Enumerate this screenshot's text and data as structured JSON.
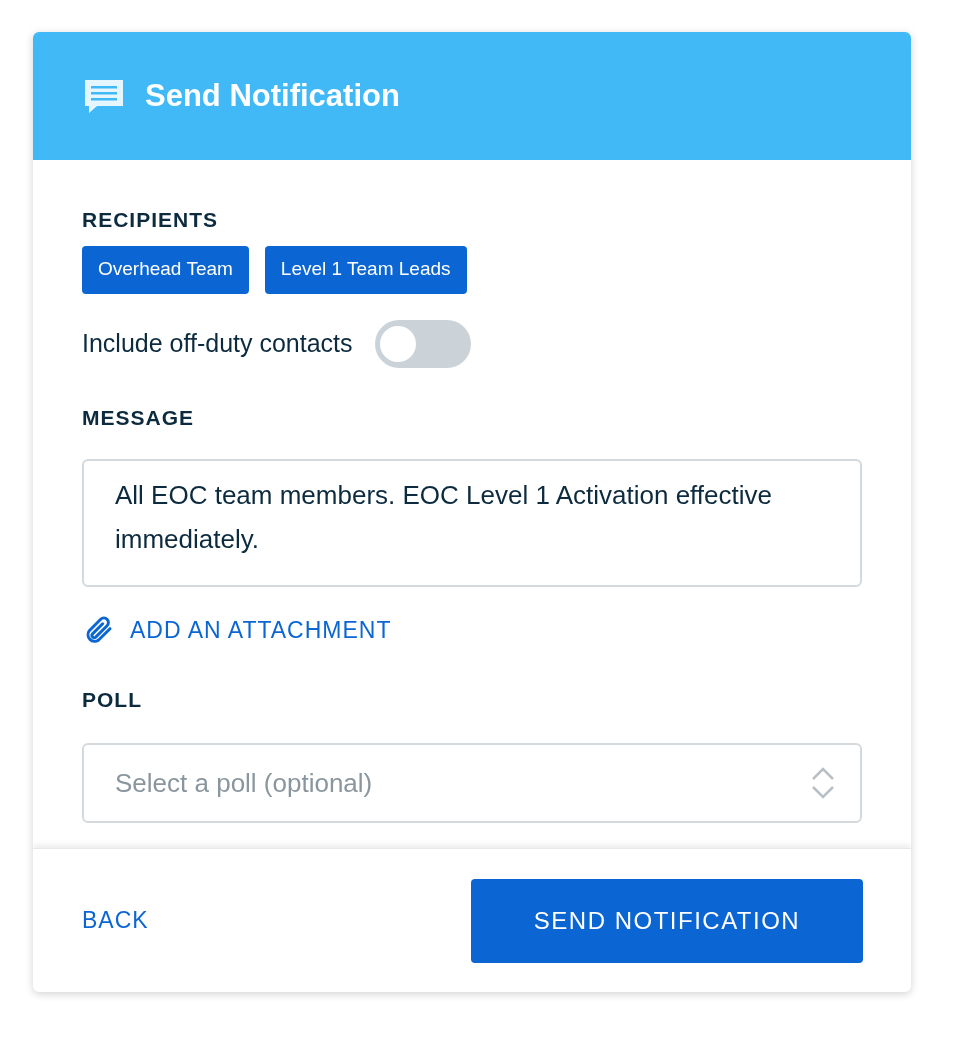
{
  "header": {
    "title": "Send Notification"
  },
  "recipients": {
    "label": "RECIPIENTS",
    "tags": [
      "Overhead Team",
      "Level 1 Team Leads"
    ]
  },
  "off_duty": {
    "label": "Include off-duty contacts",
    "on": false
  },
  "message": {
    "label": "MESSAGE",
    "value": "All EOC team members. EOC Level 1 Activation effective immediately."
  },
  "attachment": {
    "label": "ADD AN ATTACHMENT"
  },
  "poll": {
    "label": "POLL",
    "placeholder": "Select a poll (optional)"
  },
  "footer": {
    "back": "BACK",
    "send": "SEND NOTIFICATION"
  }
}
